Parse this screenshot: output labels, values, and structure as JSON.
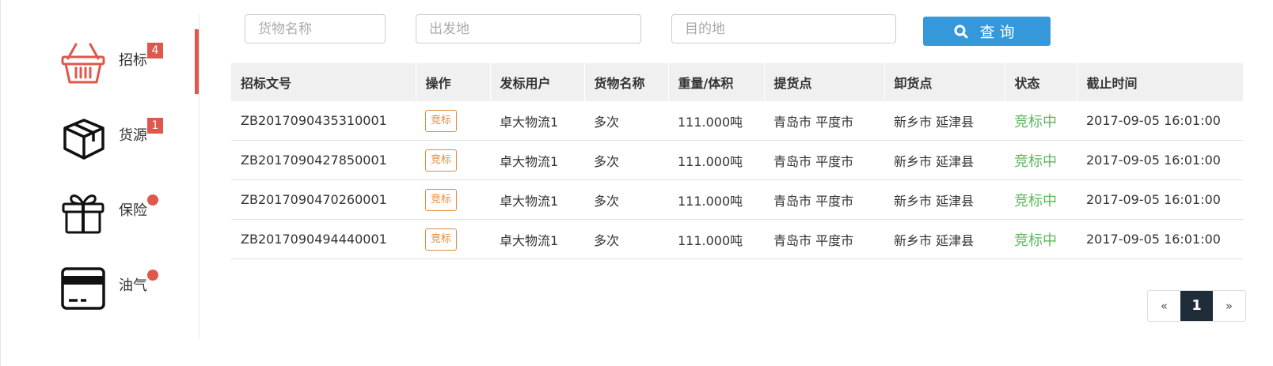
{
  "sidebar": {
    "items": [
      {
        "label": "招标",
        "badge": "4",
        "icon": "basket-icon"
      },
      {
        "label": "货源",
        "badge": "1",
        "icon": "box-icon"
      },
      {
        "label": "保险",
        "icon": "gift-icon"
      },
      {
        "label": "油气",
        "icon": "card-icon"
      }
    ]
  },
  "search": {
    "cargo_placeholder": "货物名称",
    "origin_placeholder": "出发地",
    "dest_placeholder": "目的地",
    "button_label": "查询"
  },
  "table": {
    "headers": [
      "招标文号",
      "操作",
      "发标用户",
      "货物名称",
      "重量/体积",
      "提货点",
      "卸货点",
      "状态",
      "截止时间"
    ],
    "rows": [
      {
        "doc_no": "ZB2017090435310001",
        "action": "竞标",
        "user": "卓大物流1",
        "cargo": "多次",
        "weight": "111.000吨",
        "pickup": "青岛市 平度市",
        "unload": "新乡市 延津县",
        "status": "竞标中",
        "deadline": "2017-09-05 16:01:00"
      },
      {
        "doc_no": "ZB2017090427850001",
        "action": "竞标",
        "user": "卓大物流1",
        "cargo": "多次",
        "weight": "111.000吨",
        "pickup": "青岛市 平度市",
        "unload": "新乡市 延津县",
        "status": "竞标中",
        "deadline": "2017-09-05 16:01:00"
      },
      {
        "doc_no": "ZB2017090470260001",
        "action": "竞标",
        "user": "卓大物流1",
        "cargo": "多次",
        "weight": "111.000吨",
        "pickup": "青岛市 平度市",
        "unload": "新乡市 延津县",
        "status": "竞标中",
        "deadline": "2017-09-05 16:01:00"
      },
      {
        "doc_no": "ZB2017090494440001",
        "action": "竞标",
        "user": "卓大物流1",
        "cargo": "多次",
        "weight": "111.000吨",
        "pickup": "青岛市 平度市",
        "unload": "新乡市 延津县",
        "status": "竞标中",
        "deadline": "2017-09-05 16:01:00"
      }
    ]
  },
  "pagination": {
    "prev": "«",
    "current": "1",
    "next": "»"
  },
  "colors": {
    "accent_red": "#e0584b",
    "primary_blue": "#3498db",
    "status_green": "#5cb85c",
    "action_orange": "#e58a3c",
    "pager_active": "#1f2d3a"
  }
}
